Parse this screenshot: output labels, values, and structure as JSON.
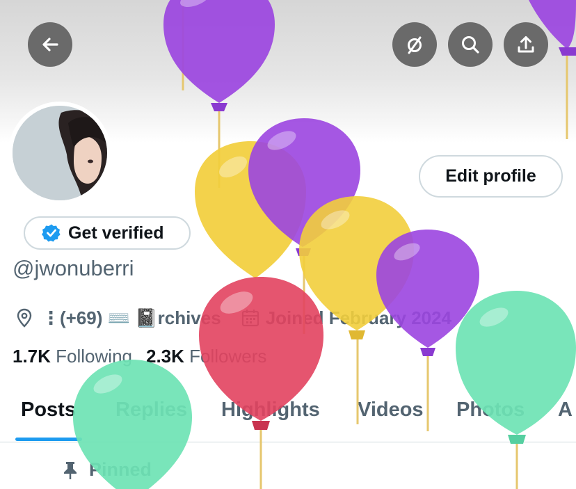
{
  "header": {
    "back_icon": "arrow-left-icon",
    "actions": [
      {
        "icon": "circle-slash-icon"
      },
      {
        "icon": "search-icon"
      },
      {
        "icon": "share-upload-icon"
      }
    ],
    "colors": {
      "button_bg": "#6a6a6a"
    }
  },
  "profile": {
    "edit_label": "Edit profile",
    "get_verified_label": "Get verified",
    "handle": "@jwonuberri",
    "meta": {
      "location_prefix": "⋮(+69) ⌨️ 📓",
      "location_word": "rchives",
      "joined": "Joined February 2024"
    },
    "following_count": "1.7K",
    "following_label": "Following",
    "followers_count": "2.3K",
    "followers_label": "Followers"
  },
  "tabs": [
    {
      "label": "Posts",
      "active": true
    },
    {
      "label": "Replies"
    },
    {
      "label": "Highlights"
    },
    {
      "label": "Videos"
    },
    {
      "label": "Photos"
    },
    {
      "label": "A"
    }
  ],
  "pinned_label": "Pinned",
  "colors": {
    "accent": "#1d9bf0",
    "balloon_purple": "#9b45e0",
    "balloon_yellow": "#f2ce3c",
    "balloon_red": "#e2425f",
    "balloon_green": "#6ee3b4"
  }
}
